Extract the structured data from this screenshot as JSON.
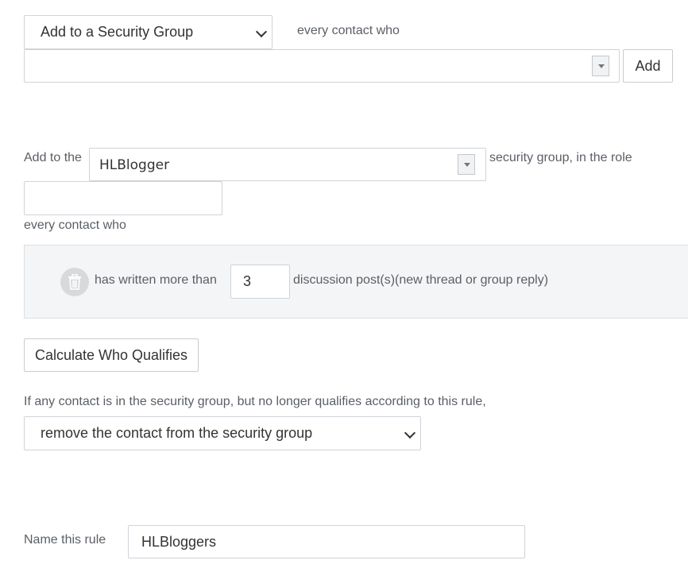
{
  "action_select": {
    "value": "Add to a Security Group"
  },
  "every_contact_who_1": "every contact who",
  "criteria_combo": {
    "value": ""
  },
  "add_button": "Add",
  "rule": {
    "prefix": "Add to the",
    "group_value": "HLBlogger",
    "suffix": "security group, in the role",
    "role_value": "",
    "every_contact_who": "every contact who"
  },
  "condition": {
    "prefix": "has written more than",
    "count": "3",
    "suffix": "discussion post(s)(new thread or group reply)"
  },
  "calculate_button": "Calculate Who Qualifies",
  "no_longer_qualifies": {
    "text": "If any contact is in the security group, but no longer qualifies according to this rule,",
    "select_value": "remove the contact from the security group"
  },
  "name_rule": {
    "label": "Name this rule",
    "value": "HLBloggers"
  }
}
